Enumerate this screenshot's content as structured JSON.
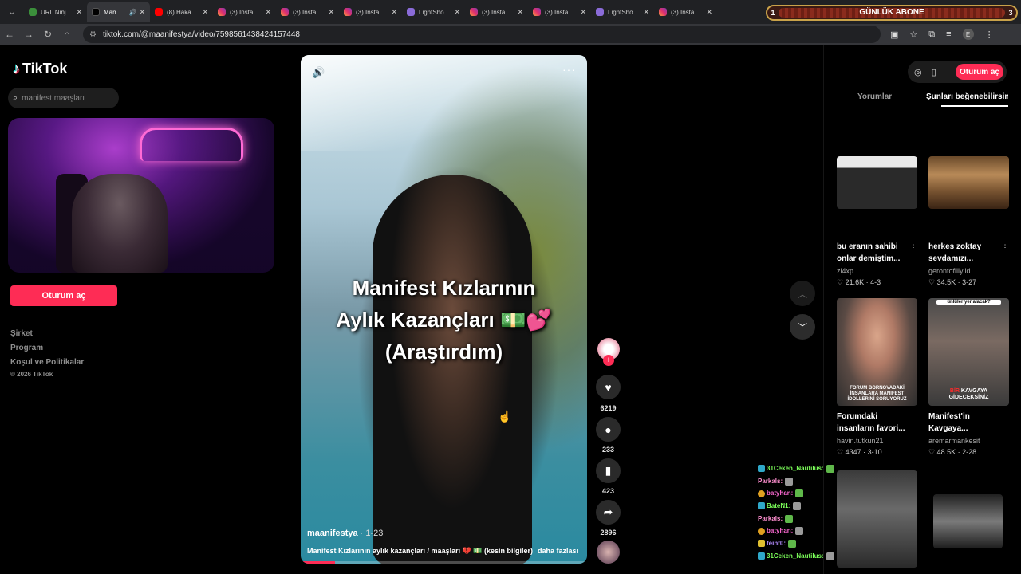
{
  "browser": {
    "tabs": [
      {
        "title": "URL Ninj",
        "favicon": "url-ninja",
        "active": false
      },
      {
        "title": "Man",
        "favicon": "tiktok",
        "active": true,
        "audio": true
      },
      {
        "title": "(8) Haka",
        "favicon": "youtube",
        "active": false
      },
      {
        "title": "(3) Insta",
        "favicon": "instagram",
        "active": false
      },
      {
        "title": "(3) Insta",
        "favicon": "instagram",
        "active": false
      },
      {
        "title": "(3) Insta",
        "favicon": "instagram",
        "active": false
      },
      {
        "title": "LightSho",
        "favicon": "lightshot",
        "active": false
      },
      {
        "title": "(3) Insta",
        "favicon": "instagram",
        "active": false
      },
      {
        "title": "(3) Insta",
        "favicon": "instagram",
        "active": false
      },
      {
        "title": "LightSho",
        "favicon": "lightshot",
        "active": false
      },
      {
        "title": "(3) Insta",
        "favicon": "instagram",
        "active": false
      }
    ],
    "url": "tiktok.com/@maanifestya/video/7598561438424157448"
  },
  "stream_overlay": {
    "goal_label": "GÜNLÜK ABONE",
    "left_value": "1",
    "right_value": "3"
  },
  "sidebar": {
    "logo": "TikTok",
    "search_placeholder": "manifest maaşları",
    "signin_label": "Oturum aç",
    "links": [
      "Şirket",
      "Program",
      "Koşul ve Politikalar"
    ],
    "copyright": "© 2026 TikTok"
  },
  "video": {
    "caption_lines": [
      "Manifest Kızlarının",
      "Aylık Kazançları 💵💕",
      "(Araştırdım)"
    ],
    "author": "maanifestya",
    "date": "· 1-23",
    "description": "Manifest Kızlarının aylık kazançları / maaşları 💔 💵 (kesin bilgiler)",
    "more_label": "daha fazlası",
    "progress": 0.12
  },
  "actions": {
    "likes": "6219",
    "comments": "233",
    "saves": "423",
    "shares": "2896"
  },
  "right_panel": {
    "signin_label": "Oturum aç",
    "tab_comments": "Yorumlar",
    "tab_related": "Şunları beğenebilirsin",
    "cards": [
      {
        "title": "bu eranın sahibi onlar demiştim...",
        "author": "zl4xp",
        "stats": "♡ 21.6K · 4-3"
      },
      {
        "title": "herkes zoktay sevdamızı...",
        "author": "gerontofiliyiid",
        "stats": "♡ 34.5K · 3-27"
      },
      {
        "title": "Forumdaki insanların favori...",
        "author": "havin.tutkun21",
        "stats": "♡ 4347 · 3-10",
        "overlay": "FORUM BORNOVADAKİ İNSANLARA MANIFEST İDOLLERİNİ SORUYORUZ"
      },
      {
        "title": "Manifest'in Kavgaya...",
        "author": "aremarmankesit",
        "stats": "♡ 48.5K · 2-28",
        "top_label": "ünlüler yer alacak?",
        "bottom_red": "BİR",
        "bottom_white": " KAVGAYA",
        "bottom_line2": "GİDECEKSİNİZ"
      }
    ]
  },
  "chat": [
    {
      "user": "31Ceken_Nautilus:",
      "color": "#7cff5a",
      "badge": "blue"
    },
    {
      "user": "Parkals:",
      "color": "#ff8fd0",
      "badge": "none"
    },
    {
      "user": "batyhan:",
      "color": "#ff6ad5",
      "badge": "gold"
    },
    {
      "user": "BateN1:",
      "color": "#7cff5a",
      "badge": "blue"
    },
    {
      "user": "Parkals:",
      "color": "#ff8fd0",
      "badge": "none"
    },
    {
      "user": "batyhan:",
      "color": "#ff6ad5",
      "badge": "gold"
    },
    {
      "user": "feint0:",
      "color": "#b48cff",
      "badge": "crown"
    },
    {
      "user": "31Ceken_Nautilus:",
      "color": "#7cff5a",
      "badge": "blue"
    }
  ],
  "colors": {
    "accent": "#fe2c55",
    "bg": "#000000"
  }
}
